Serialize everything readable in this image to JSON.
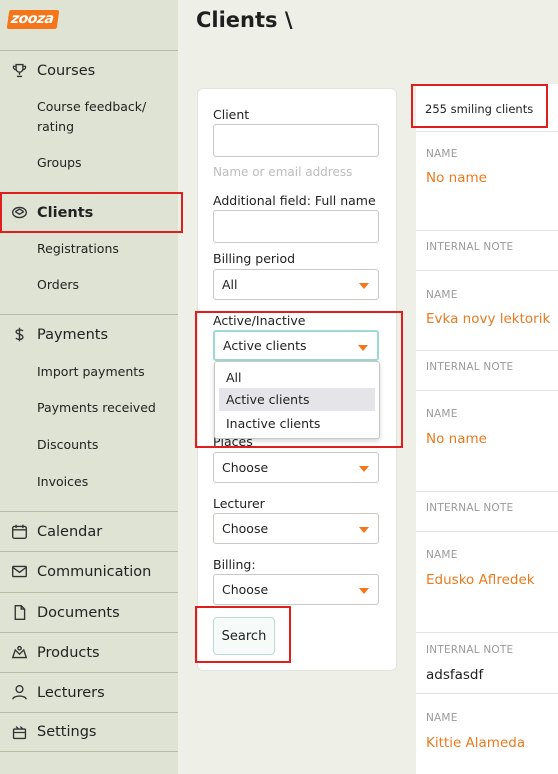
{
  "app": {
    "logo_text": "zooza",
    "brand_color": "#f5761a"
  },
  "header": {
    "title": "Clients \\"
  },
  "sidebar": {
    "items": [
      {
        "label": "Courses",
        "icon": "trophy-icon",
        "type": "main"
      },
      {
        "label": "Course feedback/",
        "type": "sub"
      },
      {
        "label": "rating",
        "type": "sub"
      },
      {
        "label": "Groups",
        "type": "sub"
      },
      {
        "label": "Clients",
        "icon": "clients-icon",
        "type": "main",
        "active": true
      },
      {
        "label": "Registrations",
        "type": "sub"
      },
      {
        "label": "Orders",
        "type": "sub"
      },
      {
        "label": "Payments",
        "icon": "dollar-icon",
        "type": "main"
      },
      {
        "label": "Import payments",
        "type": "sub"
      },
      {
        "label": "Payments received",
        "type": "sub"
      },
      {
        "label": "Discounts",
        "type": "sub"
      },
      {
        "label": "Invoices",
        "type": "sub"
      },
      {
        "label": "Calendar",
        "icon": "calendar-icon",
        "type": "main"
      },
      {
        "label": "Communication",
        "icon": "envelope-icon",
        "type": "main"
      },
      {
        "label": "Documents",
        "icon": "document-icon",
        "type": "main"
      },
      {
        "label": "Products",
        "icon": "products-icon",
        "type": "main"
      },
      {
        "label": "Lecturers",
        "icon": "user-icon",
        "type": "main"
      },
      {
        "label": "Settings",
        "icon": "settings-icon",
        "type": "main"
      }
    ]
  },
  "filters": {
    "client_label": "Client",
    "client_hint": "Name or email address",
    "additional_label": "Additional field: Full name",
    "billing_period_label": "Billing period",
    "billing_period_value": "All",
    "active_label": "Active/Inactive",
    "active_value": "Active clients",
    "active_options": [
      "All",
      "Active clients",
      "Inactive clients"
    ],
    "places_label": "Places",
    "places_value": "Choose",
    "lecturer_label": "Lecturer",
    "lecturer_value": "Choose",
    "billing_label": "Billing:",
    "billing_value": "Choose",
    "search_label": "Search"
  },
  "clients_list": {
    "count_text": "255 smiling clients",
    "name_label": "NAME",
    "note_label": "INTERNAL NOTE",
    "clients": [
      {
        "name": "No name",
        "note": ""
      },
      {
        "name": "Evka novy lektorik",
        "note": ""
      },
      {
        "name": "No name",
        "note": ""
      },
      {
        "name": "Edusko Aflredek",
        "note": "adsfasdf"
      },
      {
        "name": "Kittie Alameda",
        "note": ""
      }
    ]
  },
  "colors": {
    "accent": "#f5761a",
    "annotation": "#e01e1e",
    "sidebar_bg": "#dfe3d3",
    "page_bg": "#eeefe7"
  }
}
